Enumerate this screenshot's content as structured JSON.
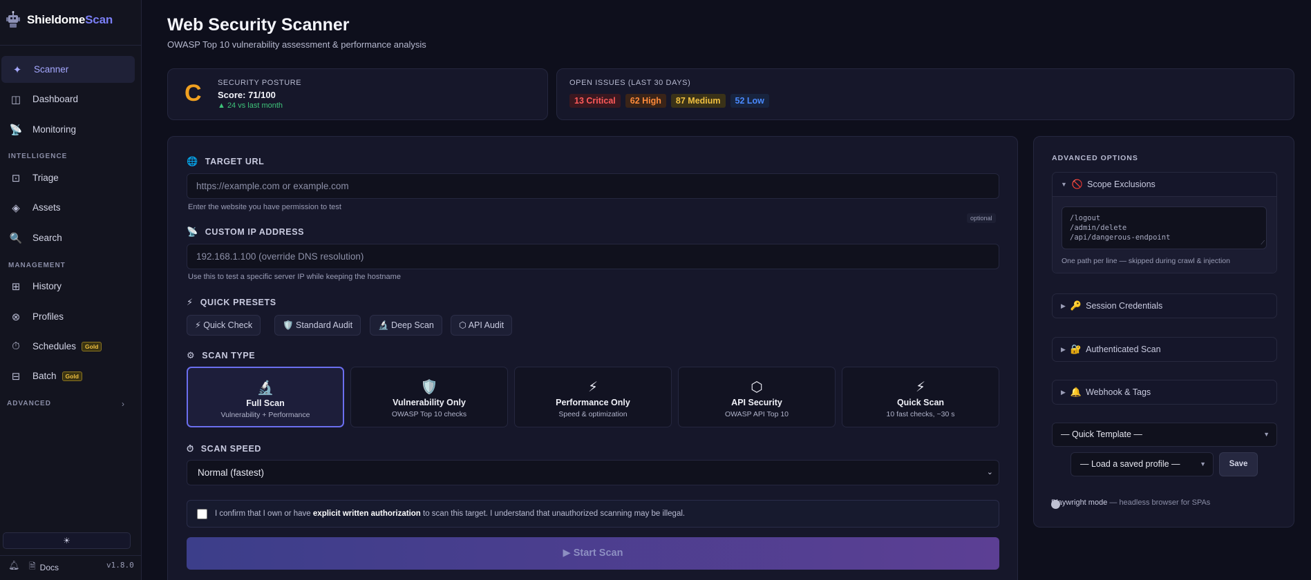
{
  "brand": {
    "name_a": "Shieldome",
    "name_b": "Scan"
  },
  "sidebar": {
    "items": [
      {
        "label": "Scanner",
        "icon": "sparkle-icon",
        "glyph": "✦"
      },
      {
        "label": "Dashboard",
        "icon": "dashboard-icon",
        "glyph": "◫"
      },
      {
        "label": "Monitoring",
        "icon": "satellite-icon",
        "glyph": "📡"
      },
      {
        "label": "Triage",
        "icon": "triage-icon",
        "glyph": "⊡"
      },
      {
        "label": "Assets",
        "icon": "diamond-icon",
        "glyph": "◈"
      },
      {
        "label": "Search",
        "icon": "search-icon",
        "glyph": "🔍"
      },
      {
        "label": "History",
        "icon": "grid-icon",
        "glyph": "⊞"
      },
      {
        "label": "Profiles",
        "icon": "circle-x-icon",
        "glyph": "⊗"
      },
      {
        "label": "Schedules",
        "icon": "stopwatch-icon",
        "glyph": "⏱",
        "badge": "Gold"
      },
      {
        "label": "Batch",
        "icon": "batch-icon",
        "glyph": "⊟",
        "badge": "Gold"
      }
    ],
    "sections": {
      "intelligence": "INTELLIGENCE",
      "management": "MANAGEMENT",
      "advanced": "ADVANCED"
    },
    "theme_glyph": "☀",
    "docs_label": "Docs",
    "version": "v1.8.0"
  },
  "header": {
    "title": "Web Security Scanner",
    "subtitle": "OWASP Top 10 vulnerability assessment & performance analysis"
  },
  "posture": {
    "grade": "C",
    "label": "SECURITY POSTURE",
    "score": "Score: 71/100",
    "delta": "▲ 24 vs last month"
  },
  "issues": {
    "label": "OPEN ISSUES (LAST 30 DAYS)",
    "critical": "13 Critical",
    "high": "62 High",
    "medium": "87 Medium",
    "low": "52 Low"
  },
  "form": {
    "target_label": "TARGET URL",
    "target_placeholder": "https://example.com  or  example.com",
    "target_help": "Enter the website you have permission to test",
    "ip_label": "CUSTOM IP ADDRESS",
    "ip_optional": "optional",
    "ip_placeholder": "192.168.1.100  (override DNS resolution)",
    "ip_help": "Use this to test a specific server IP while keeping the hostname",
    "presets_label": "QUICK PRESETS",
    "presets": [
      "⚡ Quick Check",
      "🛡️ Standard Audit",
      "🔬 Deep Scan",
      "⬡ API Audit"
    ],
    "scan_type_label": "SCAN TYPE",
    "scan_types": [
      {
        "icon": "🔬",
        "title": "Full Scan",
        "desc": "Vulnerability + Performance"
      },
      {
        "icon": "🛡️",
        "title": "Vulnerability Only",
        "desc": "OWASP Top 10 checks"
      },
      {
        "icon": "⚡",
        "title": "Performance Only",
        "desc": "Speed & optimization"
      },
      {
        "icon": "⬡",
        "title": "API Security",
        "desc": "OWASP API Top 10"
      },
      {
        "icon": "⚡",
        "title": "Quick Scan",
        "desc": "10 fast checks, ~30 s"
      }
    ],
    "speed_label": "SCAN SPEED",
    "speed_value": "Normal (fastest)",
    "auth_pre": "I confirm that I own or have ",
    "auth_bold": "explicit written authorization",
    "auth_post": " to scan this target. I understand that unauthorized scanning may be illegal.",
    "start_label": "▶  Start Scan"
  },
  "advanced": {
    "title": "ADVANCED OPTIONS",
    "scope_label": "Scope Exclusions",
    "scope_value": "/logout\n/admin/delete\n/api/dangerous-endpoint",
    "scope_help": "One path per line — skipped during crawl & injection",
    "session_label": "Session Credentials",
    "auth_scan_label": "Authenticated Scan",
    "webhook_label": "Webhook & Tags",
    "quick_template": "— Quick Template —",
    "load_profile": "— Load a saved profile —",
    "save_label": "Save",
    "playwright_label": "Playwright mode",
    "playwright_desc": " — headless browser for SPAs"
  },
  "colors": {
    "accent": "#7b7ff6",
    "grade": "#f0a020",
    "critical": "#ff5a5a",
    "high": "#ff8a3a",
    "medium": "#f0c040",
    "low": "#4a8aff"
  }
}
